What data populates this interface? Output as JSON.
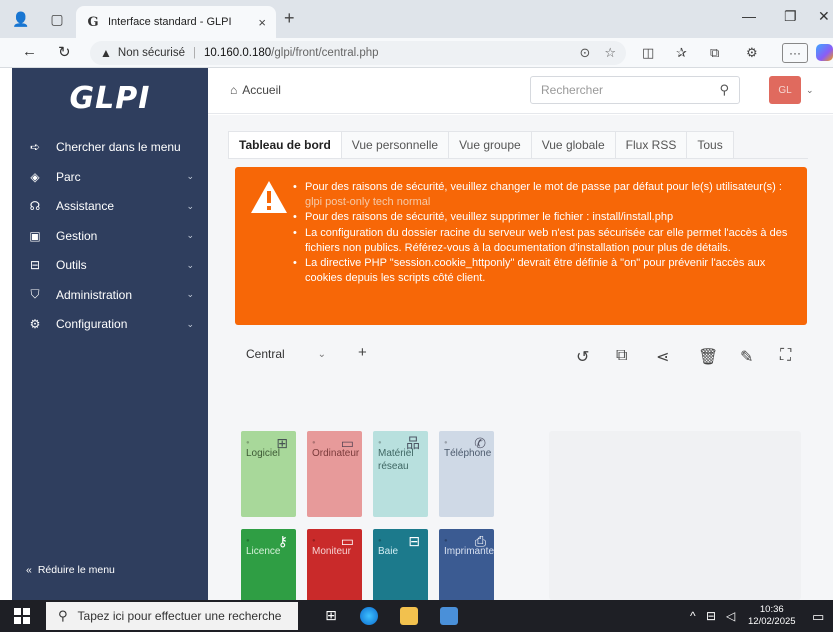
{
  "browser": {
    "tab_title": "Interface standard - GLPI",
    "tab_close": "×",
    "new_tab": "+",
    "url_insecure": "Non sécurisé",
    "url_separator": "|",
    "url_host": "10.160.0.180",
    "url_path": "/glpi/front/central.php",
    "more_label": "···"
  },
  "sidebar": {
    "logo": "GLPI",
    "search_label": "Chercher dans le menu",
    "items": [
      {
        "label": "Parc",
        "icon": "cube-icon"
      },
      {
        "label": "Assistance",
        "icon": "headset-icon"
      },
      {
        "label": "Gestion",
        "icon": "wallet-icon"
      },
      {
        "label": "Outils",
        "icon": "briefcase-icon"
      },
      {
        "label": "Administration",
        "icon": "shield-icon"
      },
      {
        "label": "Configuration",
        "icon": "gear-icon"
      }
    ],
    "reduce_label": "Réduire le menu"
  },
  "header": {
    "home_label": "Accueil",
    "search_placeholder": "Rechercher",
    "avatar_initials": "GL"
  },
  "tabs": [
    "Tableau de bord",
    "Vue personnelle",
    "Vue groupe",
    "Vue globale",
    "Flux RSS",
    "Tous"
  ],
  "alert": {
    "line1_prefix": "Pour des raisons de sécurité, veuillez changer le mot de passe par défaut pour le(s) utilisateur(s) : ",
    "line1_users": "glpi post-only tech normal",
    "line2": "Pour des raisons de sécurité, veuillez supprimer le fichier : install/install.php",
    "line3": "La configuration du dossier racine du serveur web n'est pas sécurisée car elle permet l'accès à des fichiers non publics. Référez-vous à la documentation d'installation pour plus de détails.",
    "line4": "La directive PHP \"session.cookie_httponly\" devrait être définie à \"on\" pour prévenir l'accès aux cookies depuis les scripts côté client."
  },
  "dashboard": {
    "selected": "Central",
    "add": "+"
  },
  "cards": [
    {
      "label": "Logiciel",
      "color": "#a8d89a",
      "text_color": "#3d5a35",
      "icon": "apps-icon"
    },
    {
      "label": "Ordinateur",
      "color": "#e79a9a",
      "text_color": "#7a3b3b",
      "icon": "computer-icon"
    },
    {
      "label": "Matériel réseau",
      "color": "#b8e0de",
      "text_color": "#3e6663",
      "icon": "network-icon"
    },
    {
      "label": "Téléphone",
      "color": "#cfd9e6",
      "text_color": "#4c5a6d",
      "icon": "phone-icon"
    },
    {
      "label": "Licence",
      "color": "#2f9e44",
      "text_color": "#d6f2da",
      "icon": "key-icon"
    },
    {
      "label": "Moniteur",
      "color": "#c92a2a",
      "text_color": "#f6d3d3",
      "icon": "monitor-icon"
    },
    {
      "label": "Baie",
      "color": "#1c7a8c",
      "text_color": "#d2eef3",
      "icon": "server-icon"
    },
    {
      "label": "Imprimante",
      "color": "#3b5b92",
      "text_color": "#d7e0f0",
      "icon": "printer-icon"
    }
  ],
  "taskbar": {
    "search_placeholder": "Tapez ici pour effectuer une recherche",
    "time": "10:36",
    "date": "12/02/2025"
  }
}
